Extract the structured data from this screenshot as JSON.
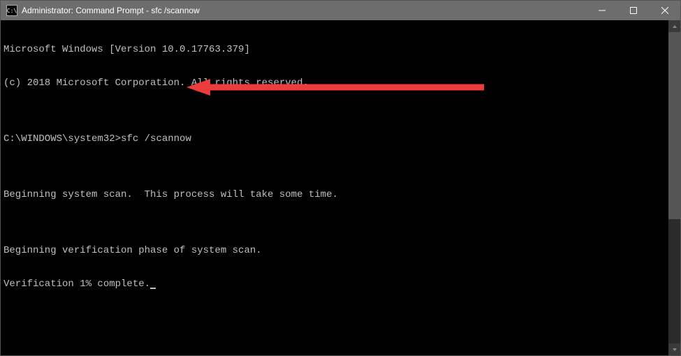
{
  "titlebar": {
    "icon_label": "C:\\",
    "title": "Administrator: Command Prompt - sfc  /scannow"
  },
  "terminal": {
    "lines": [
      "Microsoft Windows [Version 10.0.17763.379]",
      "(c) 2018 Microsoft Corporation. All rights reserved.",
      "",
      "C:\\WINDOWS\\system32>sfc /scannow",
      "",
      "Beginning system scan.  This process will take some time.",
      "",
      "Beginning verification phase of system scan.",
      "Verification 1% complete."
    ],
    "prompt": "C:\\WINDOWS\\system32>",
    "command": "sfc /scannow"
  },
  "annotation": {
    "color": "#ee3b3b"
  }
}
